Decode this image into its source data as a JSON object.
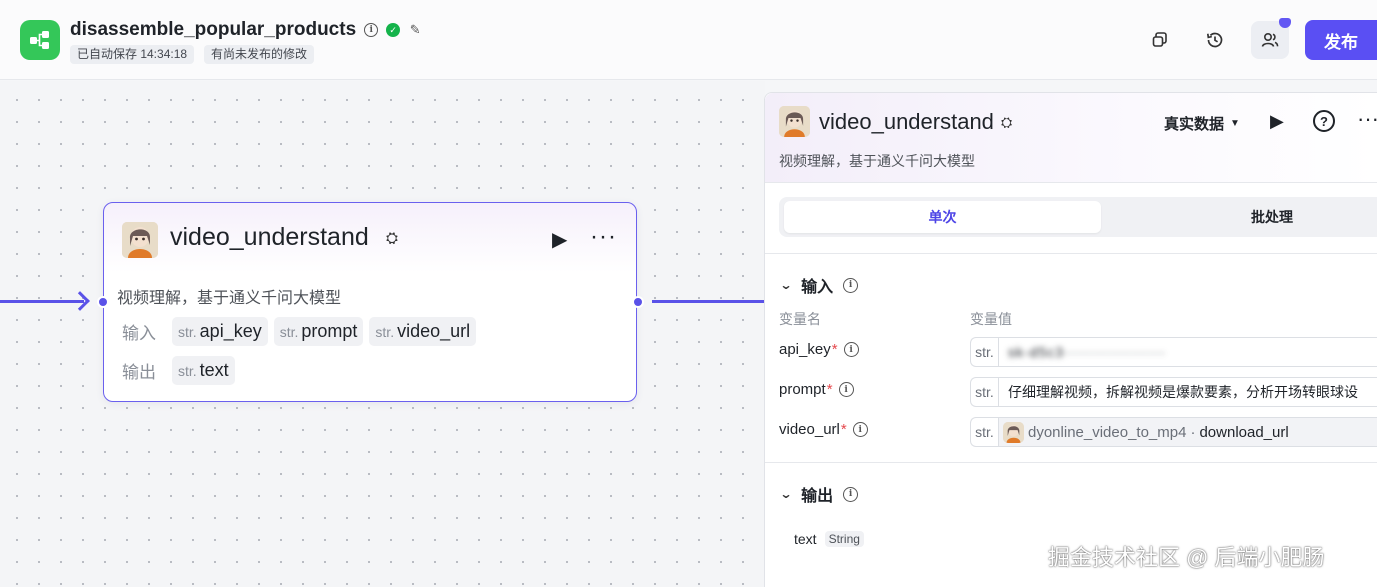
{
  "header": {
    "title": "disassemble_popular_products",
    "autosave": "已自动保存 14:34:18",
    "unpublished": "有尚未发布的修改",
    "publish_label": "发布"
  },
  "node": {
    "title": "video_understand",
    "description": "视频理解，基于通义千问大模型",
    "input_label": "输入",
    "output_label": "输出",
    "inputs": [
      {
        "type": "str.",
        "name": "api_key"
      },
      {
        "type": "str.",
        "name": "prompt"
      },
      {
        "type": "str.",
        "name": "video_url"
      }
    ],
    "outputs": [
      {
        "type": "str.",
        "name": "text"
      }
    ]
  },
  "panel": {
    "title": "video_understand",
    "description": "视频理解，基于通义千问大模型",
    "data_mode": "真实数据",
    "tabs": {
      "single": "单次",
      "batch": "批处理"
    },
    "input_section": "输入",
    "output_section": "输出",
    "col_name": "变量名",
    "col_value": "变量值",
    "variables": [
      {
        "name": "api_key",
        "required": "*",
        "type": "str.",
        "value": "sk-d5c3··················"
      },
      {
        "name": "prompt",
        "required": "*",
        "type": "str.",
        "value": "仔细理解视频，拆解视频是爆款要素，分析开场转眼球设"
      },
      {
        "name": "video_url",
        "required": "*",
        "type": "str.",
        "ref_source": "dyonline_video_to_mp4",
        "ref_sep": "·",
        "ref_field": "download_url"
      }
    ],
    "output": {
      "name": "text",
      "type": "String"
    }
  },
  "watermark": "掘金技术社区 @ 后端小肥肠",
  "colors": {
    "accent": "#5a4ff3",
    "edge": "#5a52e8",
    "logo": "#34c759",
    "required": "#e5484d",
    "success": "#14b34b"
  },
  "icons": {
    "logo": "workflow-icon",
    "info": "info-icon",
    "status": "check-circle-icon",
    "edit": "edit-icon",
    "copy": "copy-icon",
    "history": "history-icon",
    "collaborators": "users-icon",
    "run": "play-icon",
    "more": "more-icon",
    "help": "help-icon",
    "node_type": "gear-icon"
  }
}
